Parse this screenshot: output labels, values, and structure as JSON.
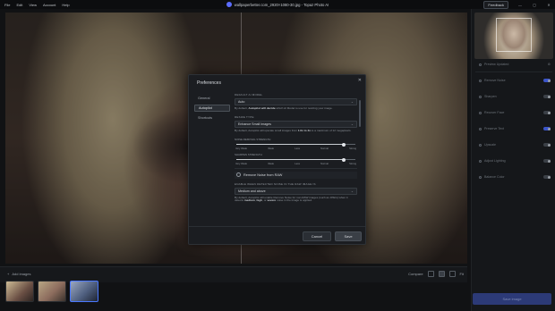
{
  "menu": [
    "File",
    "Edit",
    "View",
    "Account",
    "Help"
  ],
  "window": {
    "title": "wallpaperbetter.com_2920×1080-30.jpg - Topaz Photo AI",
    "feedback_label": "Feedback",
    "min_icon": "—",
    "max_icon": "▢",
    "close_icon": "✕"
  },
  "bottom": {
    "add_images_label": "Add images",
    "zoom_label": "Fit",
    "view_label": "Compare"
  },
  "sidebar": {
    "rows": [
      {
        "label": "Preview Updated",
        "toggle": false,
        "bright": false
      },
      {
        "label": "Remove Noise",
        "toggle": true,
        "bright": false
      },
      {
        "label": "Sharpen",
        "toggle": false,
        "bright": false
      },
      {
        "label": "Recover Face",
        "toggle": false,
        "bright": false
      },
      {
        "label": "Preserve Text",
        "toggle": true,
        "bright": false
      },
      {
        "label": "Upscale",
        "toggle": false,
        "bright": false
      },
      {
        "label": "Adjust Lighting",
        "toggle": false,
        "bright": false
      },
      {
        "label": "Balance Color",
        "toggle": false,
        "bright": false
      }
    ],
    "export_label": "Save image"
  },
  "dialog": {
    "title": "Preferences",
    "nav": [
      "General",
      "Autopilot",
      "Shortcuts"
    ],
    "active_nav": 1,
    "default_ai_model_label": "DEFAULT AI MODEL",
    "default_ai_model_value": "Auto",
    "default_ai_model_help_pre": "By default, ",
    "default_ai_model_help_bold": "Autopilot will decide",
    "default_ai_model_help_post": " which AI Model to use for resizing your image.",
    "resize_type_label": "RESIZE TYPE",
    "resize_type_value": "Enhance Small Images",
    "resize_type_help_pre": "By default, Autopilot will upscale small images from ",
    "resize_type_help_bold": "1.0x to 4x",
    "resize_type_help_post": " to a maximum of 12 megapixels.",
    "denoise_strength_label": "NOISE REMOVAL STRENGTH",
    "denoise_strength_value": 0.9,
    "denoise_ticks": [
      "Very Weak",
      "Weak",
      "Less",
      "Normal",
      "Strong"
    ],
    "sharpen_strength_label": "SHARPEN STRENGTH",
    "sharpen_strength_value": 0.9,
    "sharpen_ticks": [
      "Very Weak",
      "Weak",
      "Less",
      "Normal",
      "Strong"
    ],
    "raw_check_label": "Remove Noise from RAW",
    "raw_section_label": "ENABLE WHEN DETECTED NOISE IN THE RAW IMAGE IS",
    "raw_select_value": "Medium and above",
    "raw_help_pre": "By default, Autopilot will enable Remove Noise for non-RAW images (such as JPEG) when it detects ",
    "raw_help_bold1": "medium",
    "raw_help_mid": ", ",
    "raw_help_bold2": "high",
    "raw_help_mid2": ", or ",
    "raw_help_bold3": "severe",
    "raw_help_post": " noise in the image is applied.",
    "cancel_label": "Cancel",
    "save_label": "Save"
  },
  "colors": {
    "accent": "#3b55c9",
    "dialog_bg": "#1b1d21",
    "app_bg": "#111214"
  }
}
